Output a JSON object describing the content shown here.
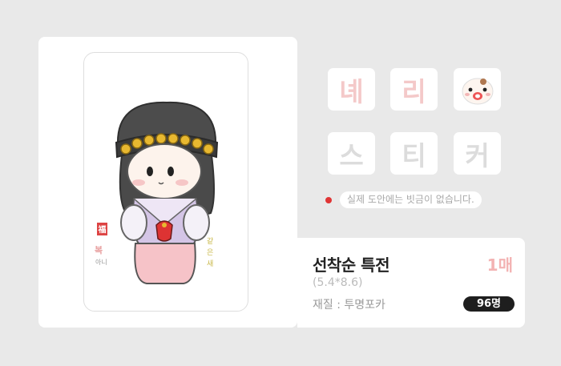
{
  "colors": {
    "background": "#e9e9e9",
    "accent_pink": "#f3b3b3",
    "notice_dot": "#e03535"
  },
  "sticker_tiles": [
    {
      "label": "녜",
      "style": "pink"
    },
    {
      "label": "리",
      "style": "pink"
    },
    {
      "label": "",
      "style": "icon",
      "icon": "baby-face-icon"
    },
    {
      "label": "스",
      "style": "gray"
    },
    {
      "label": "티",
      "style": "gray"
    },
    {
      "label": "커",
      "style": "gray"
    }
  ],
  "notice": {
    "text": "실제 도안에는 빗금이 없습니다."
  },
  "photocard": {
    "stamp_text": "福",
    "signature": "복아니 같은 새"
  },
  "info": {
    "title": "선착순 특전",
    "quantity": "1매",
    "size": "(5.4*8.6)",
    "material": "재질 : 투명포카",
    "count_badge": "96명"
  }
}
